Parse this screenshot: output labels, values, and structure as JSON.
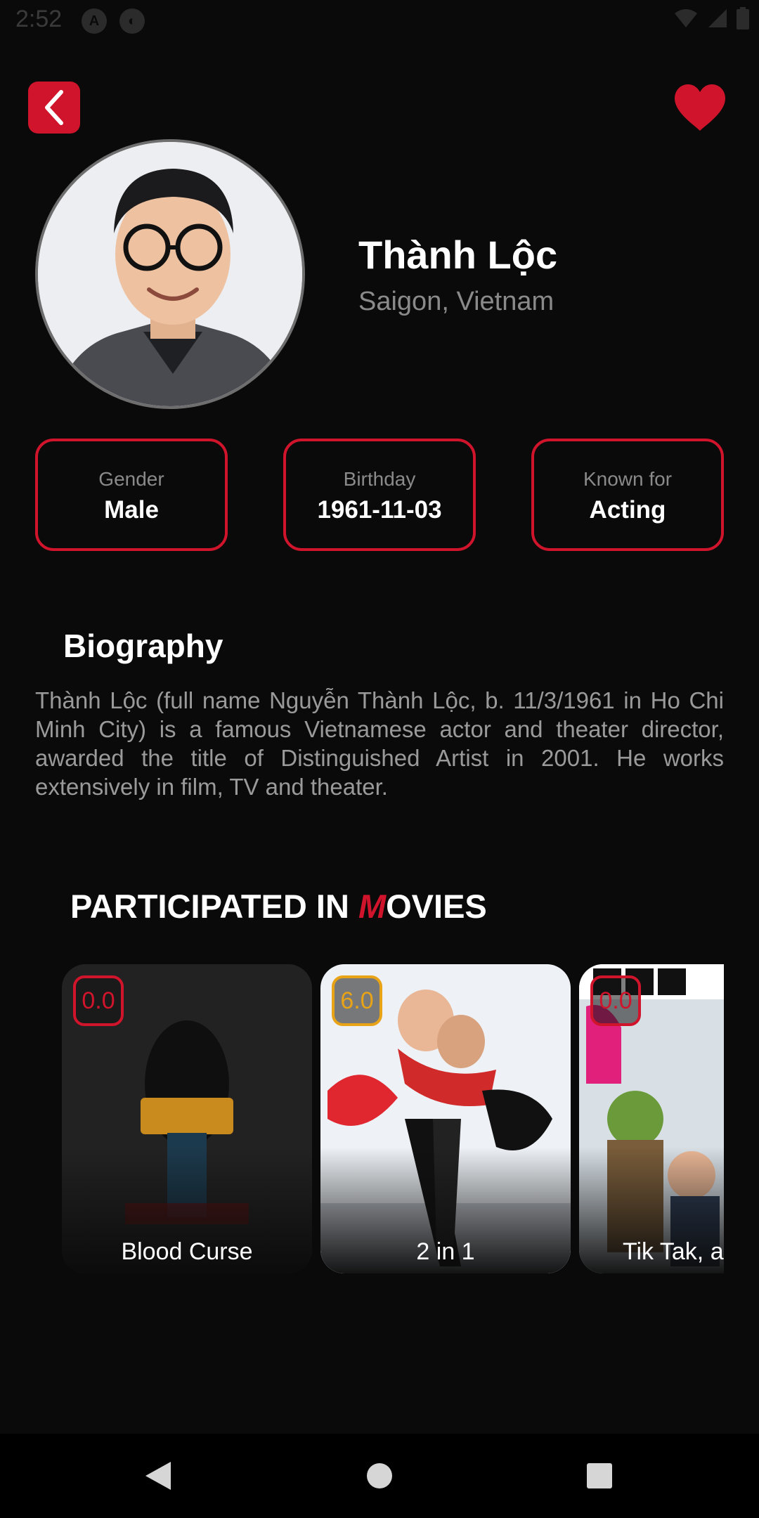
{
  "status_bar": {
    "time": "2:52"
  },
  "header": {
    "back_icon": "chevron-left-icon",
    "favorite_icon": "heart-icon"
  },
  "profile": {
    "name": "Thành Lộc",
    "place_of_birth": "Saigon, Vietnam"
  },
  "info_cards": [
    {
      "label": "Gender",
      "value": "Male"
    },
    {
      "label": "Birthday",
      "value": "1961-11-03"
    },
    {
      "label": "Known for",
      "value": "Acting"
    }
  ],
  "biography": {
    "title": "Biography",
    "text": "Thành Lộc (full name Nguyễn Thành Lộc, b. 11/3/1961 in Ho Chi Minh City) is a famous Vietnamese actor and theater director, awarded the title of Distinguished Artist in 2001. He works extensively in film, TV and theater."
  },
  "movies_section": {
    "title_prefix": "PARTICIPATED IN ",
    "title_accent": "M",
    "title_suffix": "OVIES",
    "movies": [
      {
        "title": "Blood Curse",
        "rating": "0.0",
        "rating_color": "#d0142b"
      },
      {
        "title": "2 in 1",
        "rating": "6.0",
        "rating_color": "#e8a317"
      },
      {
        "title": "Tik Tak, a",
        "rating": "0.0",
        "rating_color": "#d0142b"
      }
    ]
  },
  "nav_bar": {
    "back": "back-triangle-icon",
    "home": "home-circle-icon",
    "recents": "recents-square-icon"
  },
  "colors": {
    "accent": "#d0142b",
    "background": "#0a0a0a",
    "muted_text": "#8a8a8a",
    "rating_mid": "#e8a317"
  }
}
